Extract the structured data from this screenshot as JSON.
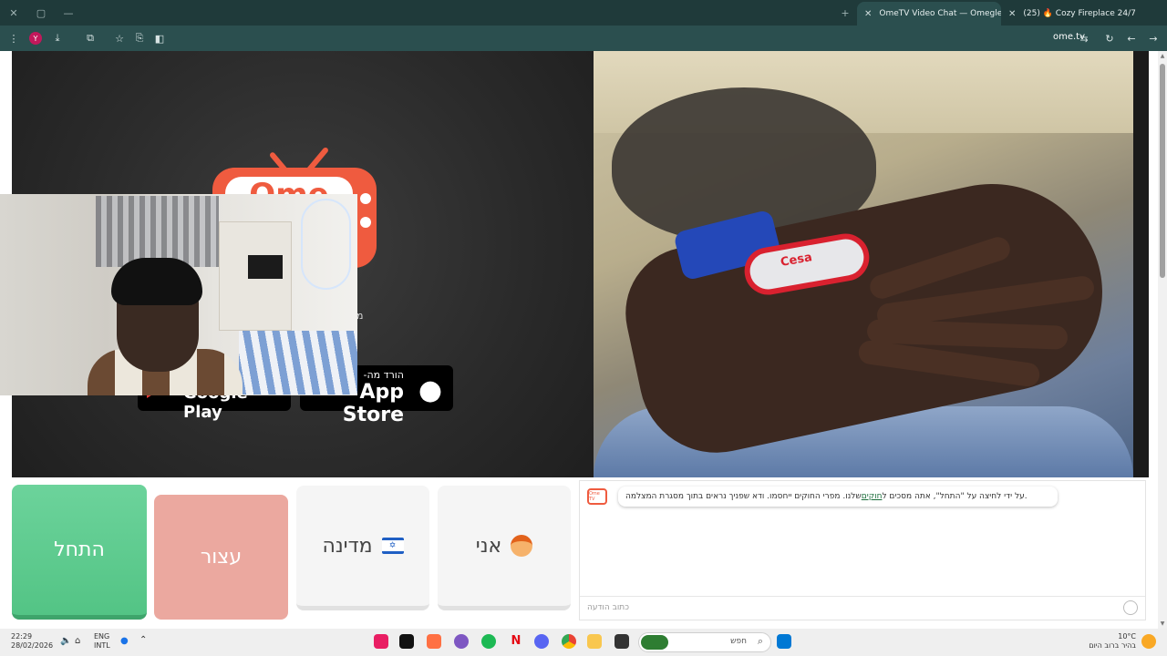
{
  "browser": {
    "tabs": [
      {
        "title": "OmeTV Video Chat — Omegle",
        "active": true
      },
      {
        "title": "(25) 🔥 Cozy Fireplace 24/7 |",
        "active": false
      }
    ],
    "new_tab_glyph": "+",
    "url": "ome.tv",
    "profile_initial": "Y",
    "icons": [
      "menu-icon",
      "profile-avatar",
      "download-icon",
      "extensions-icon",
      "star-icon",
      "tab-share-icon",
      "split-view-icon",
      "translate-icon",
      "reload-icon",
      "back-icon",
      "forward-icon"
    ]
  },
  "left_video": {
    "logo_text": "Ome",
    "appstore": {
      "small": "-הורד מה",
      "big": "App Store"
    },
    "googleplay": {
      "big": "Google Play"
    },
    "partial_label": "מ"
  },
  "right_video": {
    "keychain_text": "Cesa"
  },
  "controls": {
    "start": "התחל",
    "stop": "עצור",
    "country": "מדינה",
    "me": "אני"
  },
  "chat": {
    "logo_text": "Ome TV",
    "message_before": ".על ידי לחיצה על \"התחל\", אתה מסכים ל",
    "message_link": "חוקים",
    "message_after": " שלנו. מפרי החוקים ייחסמו. ודא שפניך נראים בתוך מסגרת המצלמה",
    "input_placeholder": "כתוב הודעה"
  },
  "taskbar": {
    "time": "22:29",
    "date": "28/02/2026",
    "lang_top": "ENG",
    "lang_bottom": "INTL",
    "search_placeholder": "חפש",
    "weather_temp": "10°C",
    "weather_desc": "בהיר ברוב היום"
  },
  "colors": {
    "start": "#5ccb8c",
    "stop": "#eba89f",
    "brand": "#ef5b3f",
    "tabbar": "#1f3a3a",
    "toolbar": "#2b4f4f"
  }
}
